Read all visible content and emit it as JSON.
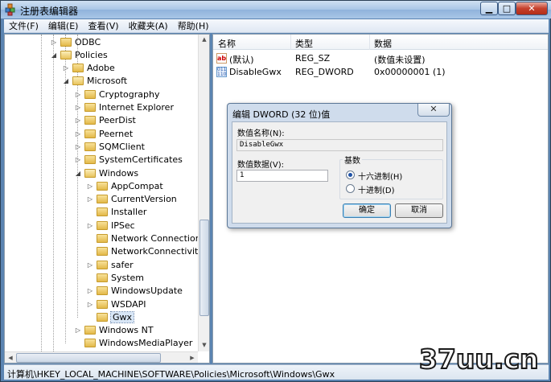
{
  "window": {
    "title": "注册表编辑器"
  },
  "menu": [
    "文件(F)",
    "编辑(E)",
    "查看(V)",
    "收藏夹(A)",
    "帮助(H)"
  ],
  "tree": [
    {
      "label": "ODBC",
      "depth": 1,
      "twisty": "collapsed"
    },
    {
      "label": "Policies",
      "depth": 1,
      "twisty": "expanded",
      "open": true
    },
    {
      "label": "Adobe",
      "depth": 2,
      "twisty": "collapsed"
    },
    {
      "label": "Microsoft",
      "depth": 2,
      "twisty": "expanded",
      "open": true
    },
    {
      "label": "Cryptography",
      "depth": 3,
      "twisty": "collapsed"
    },
    {
      "label": "Internet Explorer",
      "depth": 3,
      "twisty": "collapsed"
    },
    {
      "label": "PeerDist",
      "depth": 3,
      "twisty": "collapsed"
    },
    {
      "label": "Peernet",
      "depth": 3,
      "twisty": "collapsed"
    },
    {
      "label": "SQMClient",
      "depth": 3,
      "twisty": "collapsed"
    },
    {
      "label": "SystemCertificates",
      "depth": 3,
      "twisty": "collapsed"
    },
    {
      "label": "Windows",
      "depth": 3,
      "twisty": "expanded",
      "open": true
    },
    {
      "label": "AppCompat",
      "depth": 4,
      "twisty": "collapsed"
    },
    {
      "label": "CurrentVersion",
      "depth": 4,
      "twisty": "collapsed"
    },
    {
      "label": "Installer",
      "depth": 4,
      "twisty": "none"
    },
    {
      "label": "IPSec",
      "depth": 4,
      "twisty": "collapsed"
    },
    {
      "label": "Network Connections",
      "depth": 4,
      "twisty": "none"
    },
    {
      "label": "NetworkConnectivitySta",
      "depth": 4,
      "twisty": "none"
    },
    {
      "label": "safer",
      "depth": 4,
      "twisty": "collapsed"
    },
    {
      "label": "System",
      "depth": 4,
      "twisty": "none"
    },
    {
      "label": "WindowsUpdate",
      "depth": 4,
      "twisty": "collapsed"
    },
    {
      "label": "WSDAPI",
      "depth": 4,
      "twisty": "collapsed"
    },
    {
      "label": "Gwx",
      "depth": 4,
      "twisty": "none",
      "selected": true
    },
    {
      "label": "Windows NT",
      "depth": 3,
      "twisty": "collapsed"
    },
    {
      "label": "WindowsMediaPlayer",
      "depth": 3,
      "twisty": "none"
    }
  ],
  "values_header": {
    "name": "名称",
    "type": "类型",
    "data": "数据"
  },
  "values": [
    {
      "name": "(默认)",
      "type": "REG_SZ",
      "data": "(数值未设置)",
      "icon": "string-value-icon"
    },
    {
      "name": "DisableGwx",
      "type": "REG_DWORD",
      "data": "0x00000001 (1)",
      "icon": "dword-value-icon"
    }
  ],
  "dialog": {
    "title": "编辑 DWORD (32 位)值",
    "close": "✕",
    "name_label": "数值名称(N):",
    "name_value": "DisableGwx",
    "data_label": "数值数据(V):",
    "data_value": "1",
    "base_label": "基数",
    "hex_label": "十六进制(H)",
    "dec_label": "十进制(D)",
    "ok": "确定",
    "cancel": "取消"
  },
  "status": "计算机\\HKEY_LOCAL_MACHINE\\SOFTWARE\\Policies\\Microsoft\\Windows\\Gwx",
  "watermark": "37uu.cn"
}
